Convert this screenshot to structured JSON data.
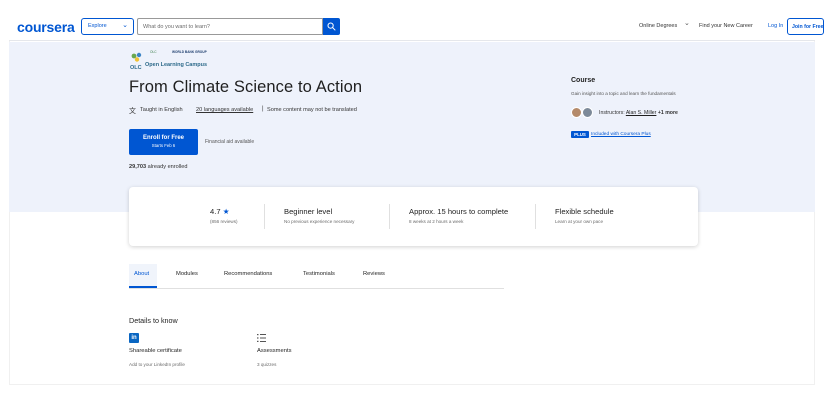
{
  "header": {
    "logo": "coursera",
    "explore_label": "Explore",
    "search_placeholder": "What do you want to learn?",
    "online_degrees": "Online Degrees",
    "find_career": "Find your New Career",
    "login": "Log In",
    "join": "Join for Free"
  },
  "hero": {
    "partner_small": "WORLD BANK GROUP",
    "partner_org": "Open Learning Campus",
    "partner_abbr": "OLC",
    "title": "From Climate Science to Action",
    "taught": "Taught in English",
    "languages": "20 languages available",
    "separator": "|",
    "not_translated": "Some content may not be translated",
    "enroll_label": "Enroll for Free",
    "enroll_sub": "Starts Feb 6",
    "financial_aid": "Financial aid available",
    "enrolled_count": "29,703",
    "enrolled_text": "already enrolled"
  },
  "side": {
    "type": "Course",
    "description": "Gain insight into a topic and learn the fundamentals",
    "instructor_prefix": "Instructors:",
    "instructor_name": "Alan S. Miller",
    "instructor_more": "+1 more",
    "plus_badge": "PLUS",
    "plus_text": "Included with Coursera Plus"
  },
  "info": {
    "rating": "4.7",
    "reviews": "(856 reviews)",
    "level": "Beginner level",
    "level_sub": "No previous experience necessary",
    "hours": "Approx. 15 hours to complete",
    "hours_sub": "8 weeks at 2 hours a week",
    "schedule": "Flexible schedule",
    "schedule_sub": "Learn at your own pace"
  },
  "tabs": [
    "About",
    "Modules",
    "Recommendations",
    "Testimonials",
    "Reviews"
  ],
  "details": {
    "title": "Details to know",
    "cert_title": "Shareable certificate",
    "cert_sub": "Add to your LinkedIn profile",
    "assess_title": "Assessments",
    "assess_sub": "3 quizzes"
  },
  "colors": {
    "brand": "#0056d2",
    "hero_bg": "#eef2fb",
    "linkedin": "#0a66c2"
  }
}
